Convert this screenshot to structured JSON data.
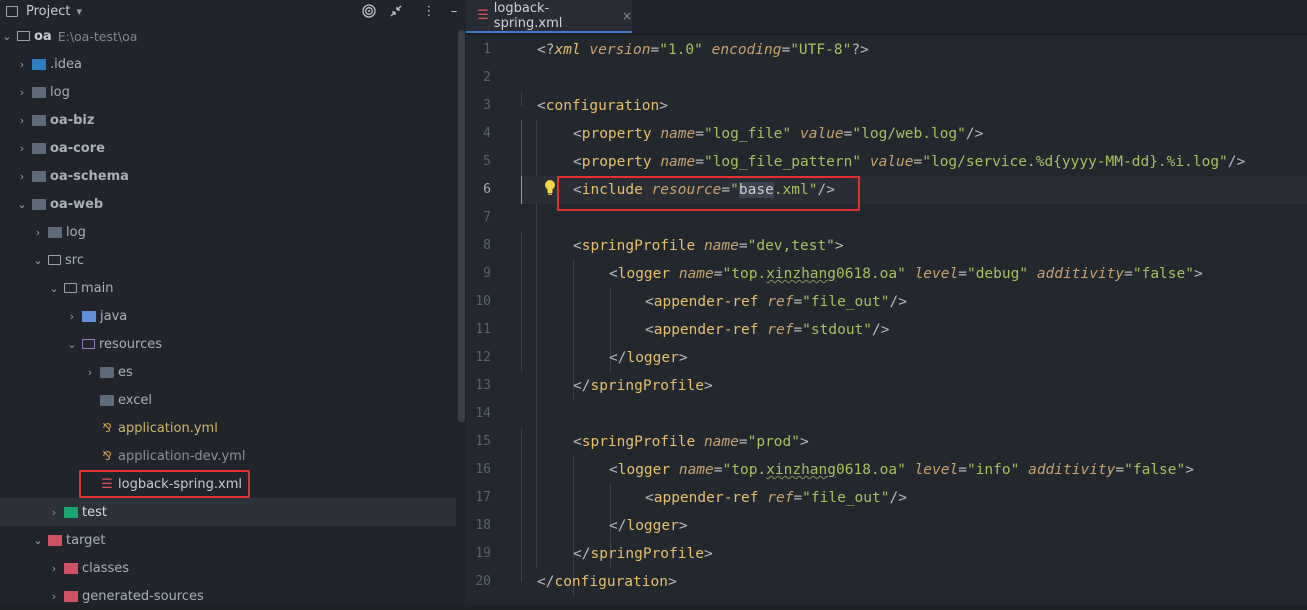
{
  "project_panel": {
    "title": "Project",
    "title_arrow": "▾",
    "tree": [
      {
        "label": "oa",
        "path": "E:\\oa-test\\oa",
        "chevron": "⌄",
        "folder": "outline",
        "bold": true
      },
      {
        "label": ".idea",
        "chevron": "›",
        "folder": "idea"
      },
      {
        "label": "log",
        "chevron": "›",
        "folder": "plain"
      },
      {
        "label": "oa-biz",
        "chevron": "›",
        "folder": "plain",
        "bold": true
      },
      {
        "label": "oa-core",
        "chevron": "›",
        "folder": "plain",
        "bold": true
      },
      {
        "label": "oa-schema",
        "chevron": "›",
        "folder": "plain",
        "bold": true
      },
      {
        "label": "oa-web",
        "chevron": "⌄",
        "folder": "plain",
        "bold": true
      },
      {
        "label": "log",
        "chevron": "›",
        "folder": "plain"
      },
      {
        "label": "src",
        "chevron": "⌄",
        "folder": "outline"
      },
      {
        "label": "main",
        "chevron": "⌄",
        "folder": "outline"
      },
      {
        "label": "java",
        "chevron": "›",
        "folder": "blue"
      },
      {
        "label": "resources",
        "chevron": "⌄",
        "folder": "outline"
      },
      {
        "label": "es",
        "chevron": "›",
        "folder": "plain"
      },
      {
        "label": "excel",
        "chevron": "",
        "folder": "plain"
      },
      {
        "label": "application.yml",
        "chevron": "",
        "file": "yml"
      },
      {
        "label": "application-dev.yml",
        "chevron": "",
        "file": "yml"
      },
      {
        "label": "logback-spring.xml",
        "chevron": "",
        "file": "xml"
      },
      {
        "label": "test",
        "chevron": "›",
        "folder": "green"
      },
      {
        "label": "target",
        "chevron": "⌄",
        "folder": "red"
      },
      {
        "label": "classes",
        "chevron": "›",
        "folder": "red"
      },
      {
        "label": "generated-sources",
        "chevron": "›",
        "folder": "red"
      }
    ]
  },
  "editor": {
    "tab_label": "logback-spring.xml",
    "tab_close": "×",
    "line_numbers": [
      "1",
      "2",
      "3",
      "4",
      "5",
      "6",
      "7",
      "8",
      "9",
      "10",
      "11",
      "12",
      "13",
      "14",
      "15",
      "16",
      "17",
      "18",
      "19",
      "20"
    ]
  },
  "code": {
    "l1": {
      "a": "<?",
      "b": "xml ",
      "c": "version",
      "d": "=",
      "e": "\"1.0\"",
      "f": " ",
      "g": "encoding",
      "h": "=",
      "i": "\"UTF-8\"",
      "j": "?>"
    },
    "l3": {
      "a": "<",
      "b": "configuration",
      "c": ">"
    },
    "l4": {
      "a": "<",
      "b": "property ",
      "c": "name",
      "d": "=",
      "e": "\"log_file\"",
      "f": " ",
      "g": "value",
      "h": "=",
      "i": "\"log/web.log\"",
      "j": "/>"
    },
    "l5": {
      "a": "<",
      "b": "property ",
      "c": "name",
      "d": "=",
      "e": "\"log_file_pattern\"",
      "f": " ",
      "g": "value",
      "h": "=",
      "i": "\"log/service.%d{yyyy-MM-dd}.%i.log\"",
      "j": "/>"
    },
    "l6": {
      "a": "<",
      "b": "include ",
      "c": "resource",
      "d": "=",
      "e1": "\"",
      "e2": "base",
      "e3": ".xml\"",
      "j": "/>"
    },
    "l8": {
      "a": "<",
      "b": "springProfile ",
      "c": "name",
      "d": "=",
      "e": "\"dev,test\"",
      "j": ">"
    },
    "l9": {
      "a": "<",
      "b": "logger ",
      "c": "name",
      "d": "=",
      "e1": "\"top.",
      "e2": "xinzhang",
      "e3": "0618.oa\"",
      "f": " ",
      "g": "level",
      "h": "=",
      "i": "\"debug\"",
      "k": " ",
      "l": "additivity",
      "m": "=",
      "n": "\"false\"",
      "j": ">"
    },
    "l10": {
      "a": "<",
      "b": "appender-ref ",
      "c": "ref",
      "d": "=",
      "e": "\"file_out\"",
      "j": "/>"
    },
    "l11": {
      "a": "<",
      "b": "appender-ref ",
      "c": "ref",
      "d": "=",
      "e": "\"stdout\"",
      "j": "/>"
    },
    "l12": {
      "a": "</",
      "b": "logger",
      "j": ">"
    },
    "l13": {
      "a": "</",
      "b": "springProfile",
      "j": ">"
    },
    "l15": {
      "a": "<",
      "b": "springProfile ",
      "c": "name",
      "d": "=",
      "e": "\"prod\"",
      "j": ">"
    },
    "l16": {
      "a": "<",
      "b": "logger ",
      "c": "name",
      "d": "=",
      "e1": "\"top.",
      "e2": "xinzhang",
      "e3": "0618.oa\"",
      "f": " ",
      "g": "level",
      "h": "=",
      "i": "\"info\"",
      "k": " ",
      "l": "additivity",
      "m": "=",
      "n": "\"false\"",
      "j": ">"
    },
    "l17": {
      "a": "<",
      "b": "appender-ref ",
      "c": "ref",
      "d": "=",
      "e": "\"file_out\"",
      "j": "/>"
    },
    "l18": {
      "a": "</",
      "b": "logger",
      "j": ">"
    },
    "l19": {
      "a": "</",
      "b": "springProfile",
      "j": ">"
    },
    "l20": {
      "a": "</",
      "b": "configuration",
      "j": ">"
    }
  },
  "colors": {
    "tag": "#e8bf6a",
    "attribute": "#bababa",
    "value": "#a5c25c",
    "highlight_box": "#e0312f",
    "accent": "#3e78d1"
  }
}
